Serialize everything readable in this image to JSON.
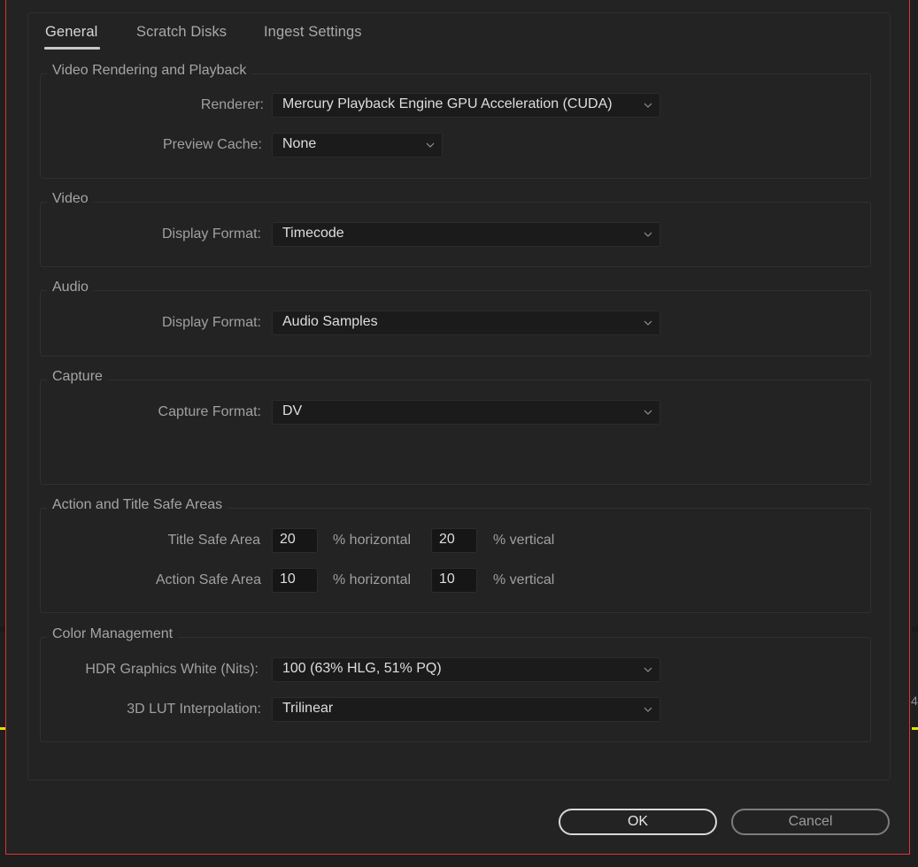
{
  "tabs": [
    {
      "label": "General",
      "active": true
    },
    {
      "label": "Scratch Disks",
      "active": false
    },
    {
      "label": "Ingest Settings",
      "active": false
    }
  ],
  "groups": {
    "video_rendering": {
      "title": "Video Rendering and Playback",
      "renderer_label": "Renderer:",
      "renderer_value": "Mercury Playback Engine GPU Acceleration (CUDA)",
      "preview_cache_label": "Preview Cache:",
      "preview_cache_value": "None"
    },
    "video": {
      "title": "Video",
      "display_format_label": "Display Format:",
      "display_format_value": "Timecode"
    },
    "audio": {
      "title": "Audio",
      "display_format_label": "Display Format:",
      "display_format_value": "Audio Samples"
    },
    "capture": {
      "title": "Capture",
      "capture_format_label": "Capture Format:",
      "capture_format_value": "DV"
    },
    "safe_areas": {
      "title": "Action and Title Safe Areas",
      "title_safe_label": "Title Safe Area",
      "title_safe_h": "20",
      "title_safe_v": "20",
      "action_safe_label": "Action Safe Area",
      "action_safe_h": "10",
      "action_safe_v": "10",
      "horizontal_unit": "% horizontal",
      "vertical_unit": "% vertical"
    },
    "color_management": {
      "title": "Color Management",
      "hdr_white_label": "HDR Graphics White (Nits):",
      "hdr_white_value": "100 (63% HLG, 51% PQ)",
      "lut_label": "3D LUT Interpolation:",
      "lut_value": "Trilinear"
    }
  },
  "buttons": {
    "ok": "OK",
    "cancel": "Cancel"
  },
  "background": {
    "fragment_text": "4"
  },
  "colors": {
    "dialog_border": "#e0303a",
    "background": "#232323",
    "timeline_marker": "#e4e000"
  }
}
